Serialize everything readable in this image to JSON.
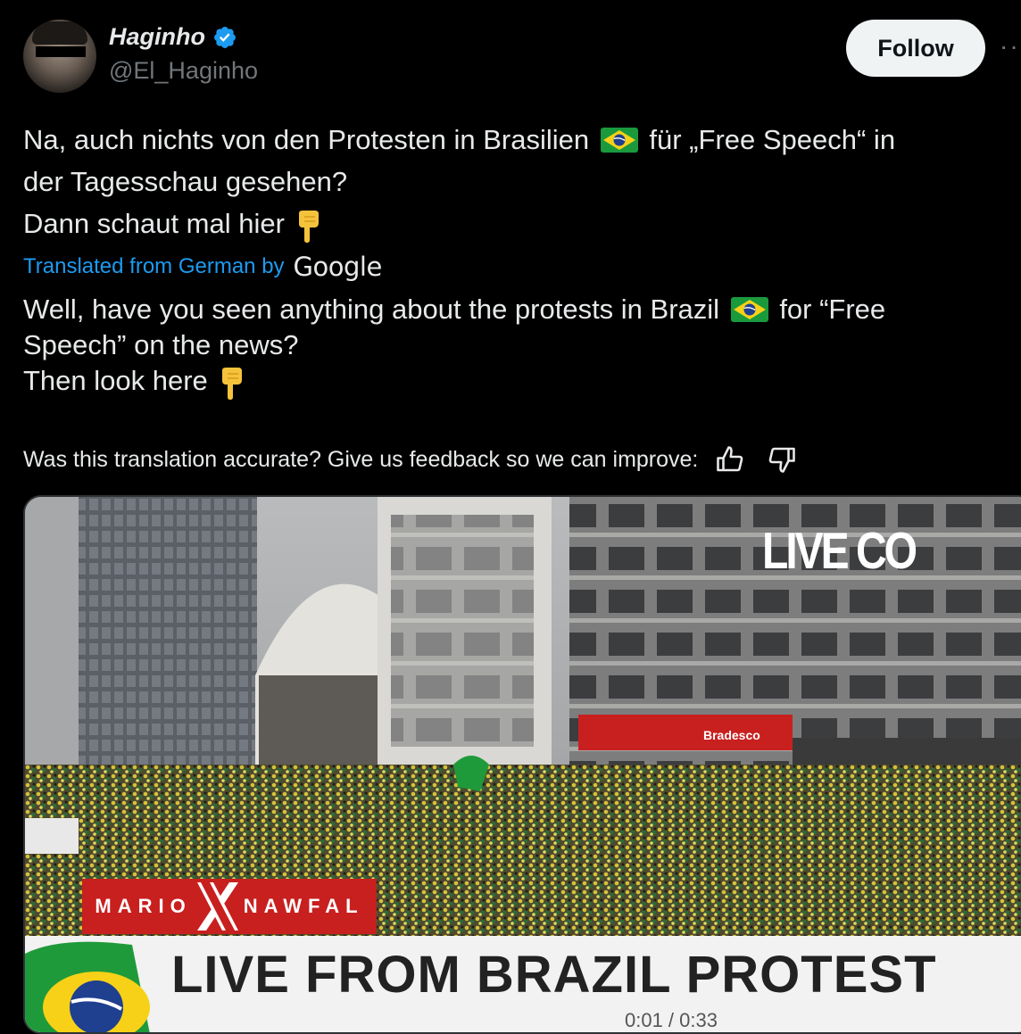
{
  "author": {
    "name": "Haginho",
    "handle": "@El_Haginho",
    "verified_color": "#1d9bf0"
  },
  "header": {
    "follow_label": "Follow",
    "more_label": "··"
  },
  "tweet": {
    "line1_a": "Na, auch nichts von den Protesten in Brasilien",
    "line1_b": "für „Free Speech“ in",
    "line2": "der Tagesschau gesehen?",
    "line3": "Dann schaut mal hier"
  },
  "translation_meta": {
    "label": "Translated from German by",
    "provider": "Google"
  },
  "translation": {
    "line1_a": "Well, have you seen anything about the protests in Brazil",
    "line1_b": "for “Free",
    "line2": "Speech” on the news?",
    "line3": "Then look here"
  },
  "feedback": {
    "prompt": "Was this translation accurate? Give us feedback so we can improve:"
  },
  "video": {
    "live_tag": "LIVE CO",
    "logo_left": "MARIO",
    "logo_right": "NAWFAL",
    "lower_third": "LIVE FROM BRAZIL PROTEST",
    "bank_sign": "Bradesco",
    "time_text": "0:01 / 0:33"
  },
  "icons": {
    "verified": "verified-badge-icon",
    "flag": "brazil-flag-emoji",
    "hand": "backhand-index-pointing-down-emoji",
    "thumbs_up": "thumbs-up-icon",
    "thumbs_down": "thumbs-down-icon"
  },
  "colors": {
    "background": "#000000",
    "text": "#e7e9ea",
    "muted": "#71767b",
    "link": "#1d9bf0",
    "follow_bg": "#eff3f4",
    "logo_red": "#c8201f"
  }
}
